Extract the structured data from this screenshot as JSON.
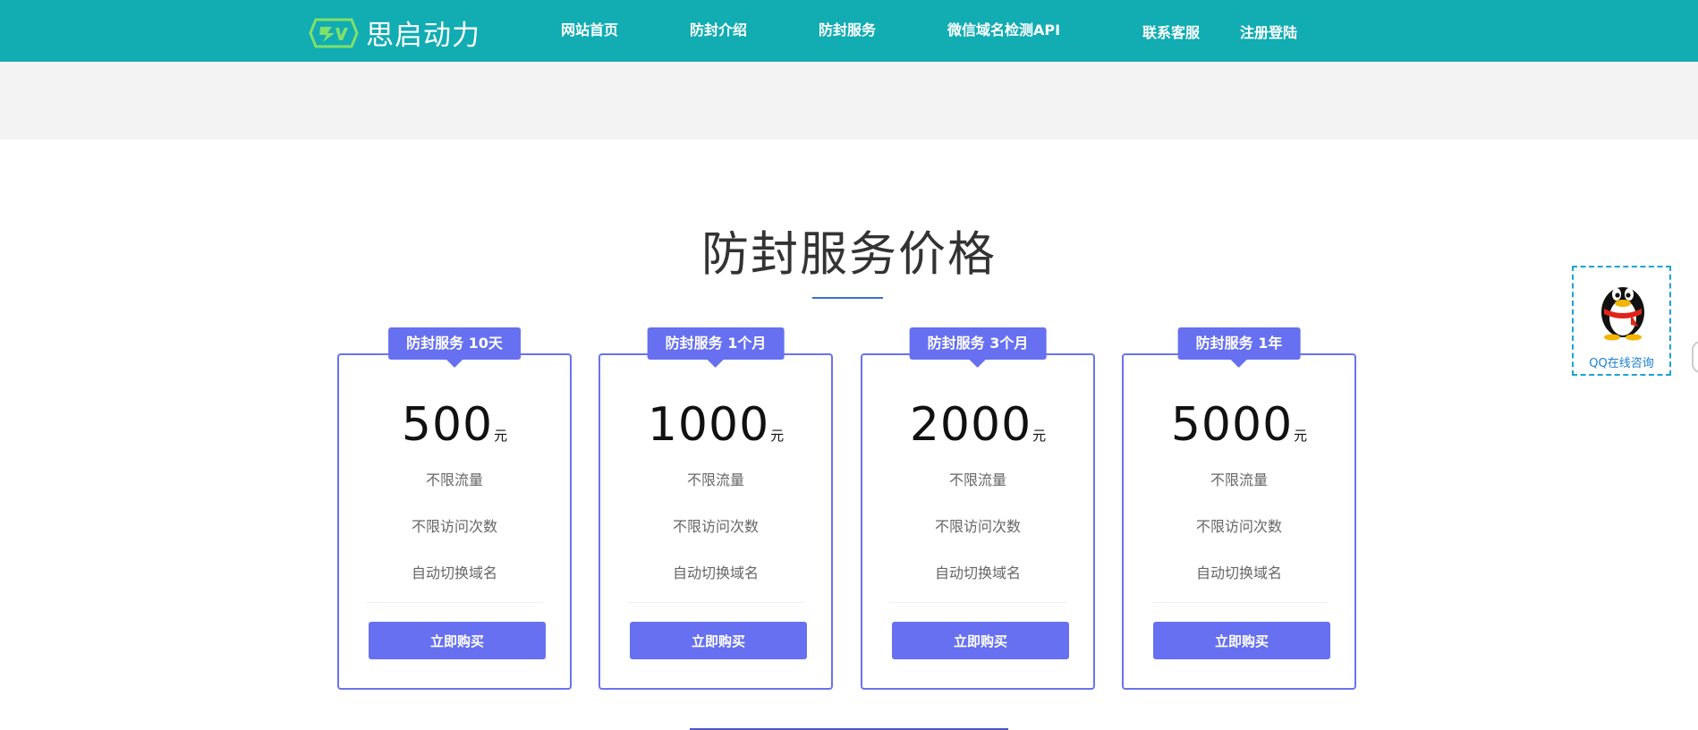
{
  "header": {
    "logo_text": "思启动力",
    "nav": [
      {
        "label": "网站首页"
      },
      {
        "label": "防封介绍"
      },
      {
        "label": "防封服务"
      },
      {
        "label": "微信域名检测API"
      },
      {
        "label": "联系客服"
      },
      {
        "label": "注册登陆"
      }
    ]
  },
  "section": {
    "title": "防封服务价格"
  },
  "plans": [
    {
      "tag": "防封服务 10天",
      "price": "500",
      "unit": "元",
      "features": [
        "不限流量",
        "不限访问次数",
        "自动切换域名"
      ],
      "button": "立即购买"
    },
    {
      "tag": "防封服务 1个月",
      "price": "1000",
      "unit": "元",
      "features": [
        "不限流量",
        "不限访问次数",
        "自动切换域名"
      ],
      "button": "立即购买"
    },
    {
      "tag": "防封服务 3个月",
      "price": "2000",
      "unit": "元",
      "features": [
        "不限流量",
        "不限访问次数",
        "自动切换域名"
      ],
      "button": "立即购买"
    },
    {
      "tag": "防封服务 1年",
      "price": "5000",
      "unit": "元",
      "features": [
        "不限流量",
        "不限访问次数",
        "自动切换域名"
      ],
      "button": "立即购买"
    }
  ],
  "qq_widget": {
    "label": "QQ在线咨询",
    "icon": "qq-penguin-icon"
  },
  "colors": {
    "header_bg": "#12acb3",
    "accent": "#6670f0",
    "banner_bg": "#f3f3f3"
  }
}
